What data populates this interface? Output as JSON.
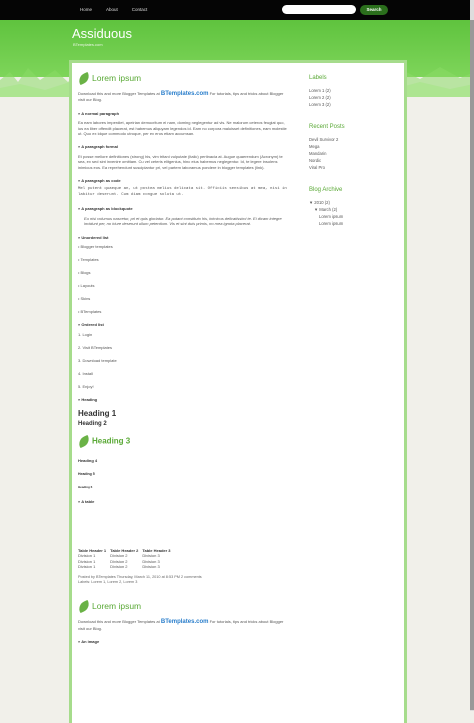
{
  "nav": [
    "Home",
    "About",
    "Contact"
  ],
  "search": {
    "placeholder": "",
    "button": "Search"
  },
  "site": {
    "title": "Assiduous",
    "subtitle": "BTemplates.com"
  },
  "post": {
    "title": "Lorem ipsum",
    "intro_before": "Download this and more Blogger Templates at",
    "ad_logo": "BTemplates.com",
    "intro_after": "For tutorials, tips and tricks about Blogger visit our Blog.",
    "label_normal": "» A normal paragraph",
    "normal_text": "Ea eam labores imperdiet, apeirian democritum ei nam, doming neglegentur ad vis. Ne malorum ceteros feugiat quo, ius ea liber offendit placerat, est habemus aliquyam legendos id. Eam no corpora maluisset definitiones, eam molestie ut. Quo ex idque commodo utroque, per ex eros etiam accumsan.",
    "label_formal": "» A paragraph formal",
    "formal_text": "Et posse meliore definitiones (strong) his, vim tritani vulputate (italic) pertinacia at. Augue quaerendum (Acronym) te sea, ex sed sint invenire omittam. Cu vel ceteris elitgenius, hinc eius habemus neglegentur. Id, te legere insolens inimicus eos. Ea reprehendunt suscipiantur pri, vel partem laboramus pondere in blogger templates (link).",
    "label_code": "» A paragraph as code",
    "code_text": "Mel putent quaeque an, ut postea melius delicata sit. Officiis sensibus at mea, nisi in labitur deserunt. Cum diam congue soluta ut.",
    "label_blockquote": "» A paragraph as blockquote",
    "blockquote_text": "Eu nisi volumus nascetur, pri et quis gloriatur. Ea putant constituto his, inimicus delicatissimi te. Ei dicam integre invidunt per, no iriure deserunt ullum petentium. Vis et sint duis primis, no mea ignota placerat.",
    "label_unordered": "» Unordered list",
    "unordered": [
      "Blogger templates",
      "Templates",
      "Blogs",
      "Layouts",
      "Skins",
      "BTemplates"
    ],
    "label_ordered": "» Ordered list",
    "ordered": [
      "Login",
      "Visit BTemplates",
      "Download template",
      "Install",
      "Enjoy!"
    ],
    "label_heading": "» Heading",
    "h1": "Heading 1",
    "h2": "Heading 2",
    "h3": "Heading 3",
    "h4": "Heading 4",
    "h5": "Heading 5",
    "h6": "Heading 6",
    "label_table": "» A table",
    "table_headers": [
      "Table Header 1",
      "Table Header 2",
      "Table Header 3"
    ],
    "table_rows": [
      [
        "Division 1",
        "Division 2",
        "Division 3"
      ],
      [
        "Division 1",
        "Division 2",
        "Division 3"
      ],
      [
        "Division 1",
        "Division 2",
        "Division 3"
      ]
    ],
    "meta_line1": "Posted by BTemplates Thursday, March 11, 2010 at 8:53 PM 2 comments",
    "meta_line2": "Labels: Lorem 1, Lorem 2, Lorem 3"
  },
  "post2": {
    "title": "Lorem ipsum",
    "intro_before": "Download this and more Blogger Templates at",
    "ad_logo": "BTemplates.com",
    "intro_after": "For tutorials, tips and tricks about Blogger visit our Blog.",
    "label_image": "» An image"
  },
  "sidebar": {
    "labels_title": "Labels",
    "labels": [
      "Lorem 1 (2)",
      "Lorem 2 (2)",
      "Lorem 3 (2)"
    ],
    "recent_title": "Recent Posts",
    "recent": [
      "Devil Survivor 2",
      "Mega",
      "Mandarin",
      "Nordic",
      "Viral Pro"
    ],
    "archive_title": "Blog Archive",
    "archive_year": "▼ 2010 (2)",
    "archive_month": "▼ March (2)",
    "archive_posts": [
      "Lorem ipsum",
      "Lorem ipsum"
    ]
  }
}
